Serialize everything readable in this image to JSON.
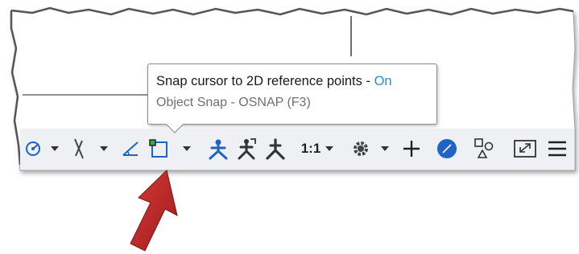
{
  "tooltip": {
    "title": "Snap cursor to 2D reference points - ",
    "state": "On",
    "subtitle": "Object Snap - OSNAP (F3)"
  },
  "statusbar": {
    "annotation_scale": "1:1",
    "items": [
      {
        "icon": "polar-tracking-icon"
      },
      {
        "icon": "orthogonal-icon"
      },
      {
        "icon": "isometric-drafting-icon"
      },
      {
        "icon": "object-snap-icon"
      },
      {
        "icon": "annotation-visibility-icon"
      },
      {
        "icon": "auto-scale-icon"
      },
      {
        "icon": "annotation-scale-icon"
      },
      {
        "icon": "workspace-gear-icon"
      },
      {
        "icon": "plus-icon"
      },
      {
        "icon": "isolate-objects-icon"
      },
      {
        "icon": "hardware-acceleration-icon"
      },
      {
        "icon": "clean-screen-icon"
      },
      {
        "icon": "customization-menu-icon"
      }
    ]
  },
  "colors": {
    "tooltip_on": "#2a8bd6",
    "accent_blue": "#1f63c4",
    "arrow_red": "#c0282a",
    "snap_green": "#2db24a"
  }
}
